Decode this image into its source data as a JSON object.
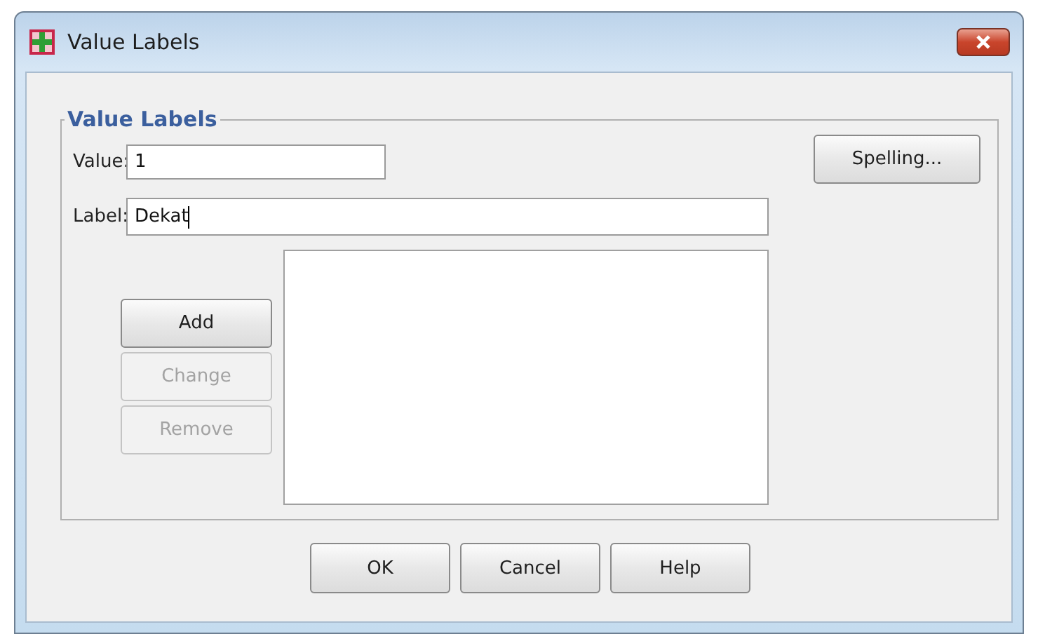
{
  "window": {
    "title": "Value Labels"
  },
  "group": {
    "legend": "Value Labels"
  },
  "fields": [
    {
      "label": "Value:",
      "value": "1",
      "kind": "short",
      "focused": false
    },
    {
      "label": "Label:",
      "value": "Dekat",
      "kind": "long",
      "focused": true
    }
  ],
  "spelling_button": {
    "label": "Spelling..."
  },
  "side_buttons": [
    {
      "label": "Add",
      "disabled": false
    },
    {
      "label": "Change",
      "disabled": true
    },
    {
      "label": "Remove",
      "disabled": true
    }
  ],
  "buttons": [
    {
      "label": "OK"
    },
    {
      "label": "Cancel"
    },
    {
      "label": "Help"
    }
  ]
}
